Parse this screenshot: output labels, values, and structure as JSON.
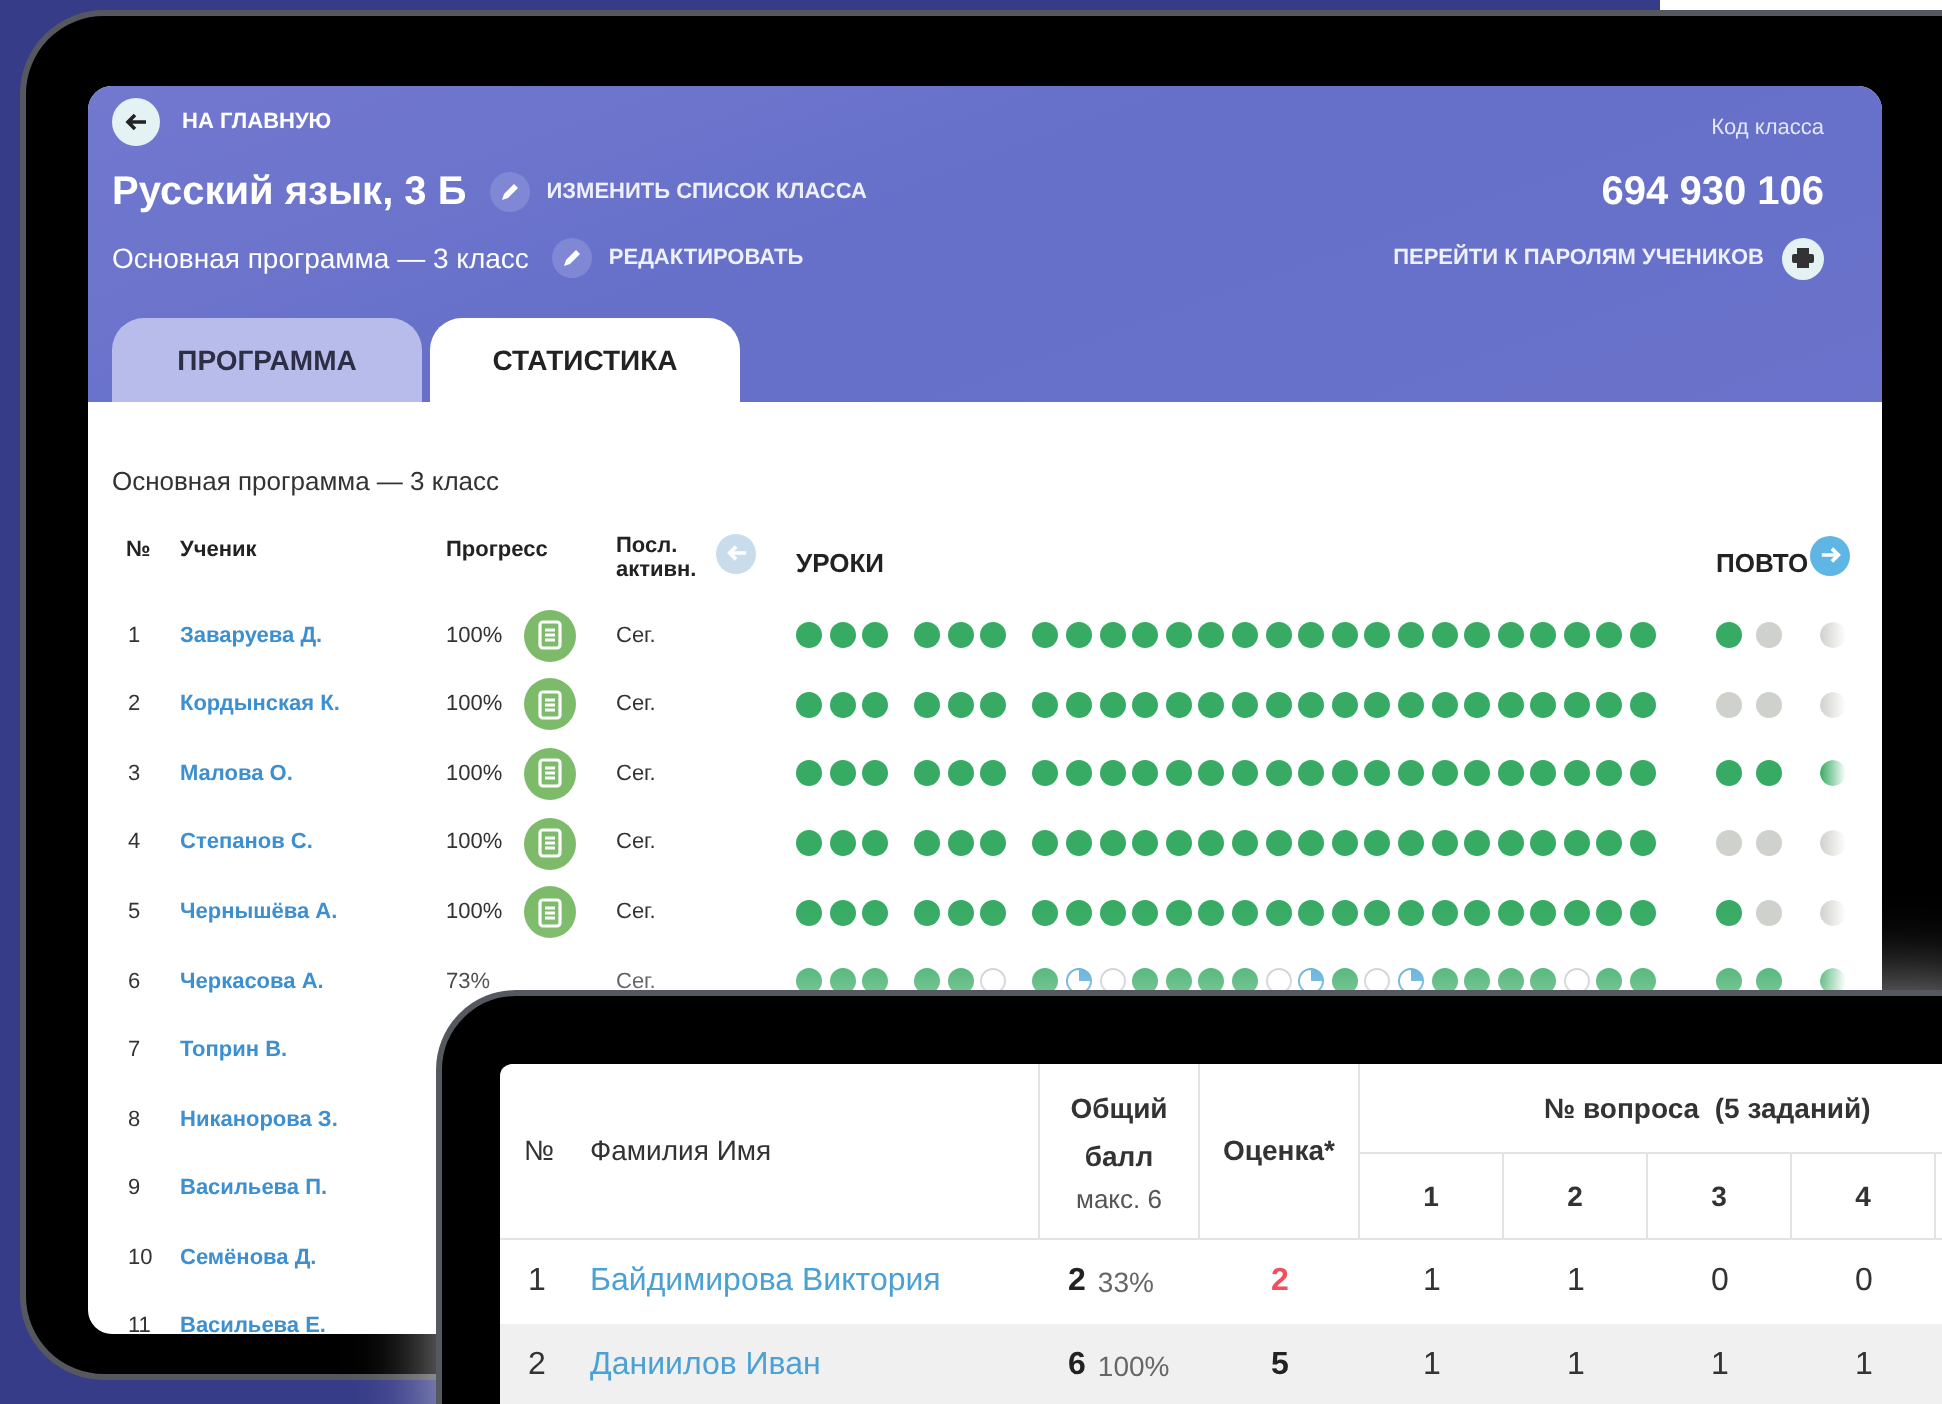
{
  "class_page": {
    "back_link": "НА ГЛАВНУЮ",
    "title": "Русский язык, 3 Б",
    "edit_list_link": "ИЗМЕНИТЬ СПИСОК КЛАССА",
    "program": "Основная программа — 3 класс",
    "edit_link": "РЕДАКТИРОВАТЬ",
    "code_label": "Код класса",
    "code": "694 930 106",
    "passwords_link": "ПЕРЕЙТИ К ПАРОЛЯМ УЧЕНИКОВ",
    "tabs": [
      {
        "label": "ПРОГРАММА",
        "selected": false
      },
      {
        "label": "СТАТИСТИКА",
        "selected": true
      }
    ],
    "section_title": "Основная программа — 3 класс",
    "columns": {
      "num": "№",
      "student": "Ученик",
      "progress": "Прогресс",
      "activity": "Посл. активн.",
      "lessons": "УРОКИ",
      "repeat": "ПОВТО"
    },
    "students": [
      {
        "num": "1",
        "name": "Заваруева Д.",
        "progress": "100%",
        "report": true,
        "activity": "Сег.",
        "lesson_groups": [
          [
            {
              "kind": "done"
            },
            {
              "kind": "done"
            },
            {
              "kind": "done"
            }
          ],
          [
            {
              "kind": "done"
            },
            {
              "kind": "done"
            },
            {
              "kind": "done"
            }
          ],
          [
            {
              "kind": "done"
            },
            {
              "kind": "done"
            },
            {
              "kind": "done"
            },
            {
              "kind": "done"
            },
            {
              "kind": "done"
            },
            {
              "kind": "done"
            },
            {
              "kind": "done"
            },
            {
              "kind": "done"
            },
            {
              "kind": "done"
            },
            {
              "kind": "done"
            },
            {
              "kind": "done"
            },
            {
              "kind": "done"
            },
            {
              "kind": "done"
            },
            {
              "kind": "done"
            },
            {
              "kind": "done"
            },
            {
              "kind": "done"
            },
            {
              "kind": "done"
            },
            {
              "kind": "done"
            },
            {
              "kind": "done"
            }
          ]
        ],
        "repeat": [
          {
            "kind": "done"
          },
          {
            "kind": "gray"
          },
          {
            "kind": "gray"
          }
        ]
      },
      {
        "num": "2",
        "name": "Кордынская К.",
        "progress": "100%",
        "report": true,
        "activity": "Сег.",
        "lesson_groups": [
          [
            {
              "kind": "done"
            },
            {
              "kind": "done"
            },
            {
              "kind": "done"
            }
          ],
          [
            {
              "kind": "done"
            },
            {
              "kind": "done"
            },
            {
              "kind": "done"
            }
          ],
          [
            {
              "kind": "done"
            },
            {
              "kind": "done"
            },
            {
              "kind": "done"
            },
            {
              "kind": "done"
            },
            {
              "kind": "done"
            },
            {
              "kind": "done"
            },
            {
              "kind": "done"
            },
            {
              "kind": "done"
            },
            {
              "kind": "done"
            },
            {
              "kind": "done"
            },
            {
              "kind": "done"
            },
            {
              "kind": "done"
            },
            {
              "kind": "done"
            },
            {
              "kind": "done"
            },
            {
              "kind": "done"
            },
            {
              "kind": "done"
            },
            {
              "kind": "done"
            },
            {
              "kind": "done"
            },
            {
              "kind": "done"
            }
          ]
        ],
        "repeat": [
          {
            "kind": "gray"
          },
          {
            "kind": "gray"
          },
          {
            "kind": "gray"
          }
        ]
      },
      {
        "num": "3",
        "name": "Малова О.",
        "progress": "100%",
        "report": true,
        "activity": "Сег.",
        "lesson_groups": [
          [
            {
              "kind": "done"
            },
            {
              "kind": "done"
            },
            {
              "kind": "done"
            }
          ],
          [
            {
              "kind": "done"
            },
            {
              "kind": "done"
            },
            {
              "kind": "done"
            }
          ],
          [
            {
              "kind": "done"
            },
            {
              "kind": "done"
            },
            {
              "kind": "done"
            },
            {
              "kind": "done"
            },
            {
              "kind": "done"
            },
            {
              "kind": "done"
            },
            {
              "kind": "done"
            },
            {
              "kind": "done"
            },
            {
              "kind": "done"
            },
            {
              "kind": "done"
            },
            {
              "kind": "done"
            },
            {
              "kind": "done"
            },
            {
              "kind": "done"
            },
            {
              "kind": "done"
            },
            {
              "kind": "done"
            },
            {
              "kind": "done"
            },
            {
              "kind": "done"
            },
            {
              "kind": "done"
            },
            {
              "kind": "done"
            }
          ]
        ],
        "repeat": [
          {
            "kind": "done"
          },
          {
            "kind": "done"
          },
          {
            "kind": "done"
          }
        ]
      },
      {
        "num": "4",
        "name": "Степанов С.",
        "progress": "100%",
        "report": true,
        "activity": "Сег.",
        "lesson_groups": [
          [
            {
              "kind": "done"
            },
            {
              "kind": "done"
            },
            {
              "kind": "done"
            }
          ],
          [
            {
              "kind": "done"
            },
            {
              "kind": "done"
            },
            {
              "kind": "done"
            }
          ],
          [
            {
              "kind": "done"
            },
            {
              "kind": "done"
            },
            {
              "kind": "done"
            },
            {
              "kind": "done"
            },
            {
              "kind": "done"
            },
            {
              "kind": "done"
            },
            {
              "kind": "done"
            },
            {
              "kind": "done"
            },
            {
              "kind": "done"
            },
            {
              "kind": "done"
            },
            {
              "kind": "done"
            },
            {
              "kind": "done"
            },
            {
              "kind": "done"
            },
            {
              "kind": "done"
            },
            {
              "kind": "done"
            },
            {
              "kind": "done"
            },
            {
              "kind": "done"
            },
            {
              "kind": "done"
            },
            {
              "kind": "done"
            }
          ]
        ],
        "repeat": [
          {
            "kind": "gray"
          },
          {
            "kind": "gray"
          },
          {
            "kind": "gray"
          }
        ]
      },
      {
        "num": "5",
        "name": "Чернышёва А.",
        "progress": "100%",
        "report": true,
        "activity": "Сег.",
        "lesson_groups": [
          [
            {
              "kind": "done"
            },
            {
              "kind": "done"
            },
            {
              "kind": "done"
            }
          ],
          [
            {
              "kind": "done"
            },
            {
              "kind": "done"
            },
            {
              "kind": "done"
            }
          ],
          [
            {
              "kind": "done"
            },
            {
              "kind": "done"
            },
            {
              "kind": "done"
            },
            {
              "kind": "done"
            },
            {
              "kind": "done"
            },
            {
              "kind": "done"
            },
            {
              "kind": "done"
            },
            {
              "kind": "done"
            },
            {
              "kind": "done"
            },
            {
              "kind": "done"
            },
            {
              "kind": "done"
            },
            {
              "kind": "done"
            },
            {
              "kind": "done"
            },
            {
              "kind": "done"
            },
            {
              "kind": "done"
            },
            {
              "kind": "done"
            },
            {
              "kind": "done"
            },
            {
              "kind": "done"
            },
            {
              "kind": "done"
            }
          ]
        ],
        "repeat": [
          {
            "kind": "done"
          },
          {
            "kind": "gray"
          },
          {
            "kind": "gray"
          }
        ]
      },
      {
        "num": "6",
        "name": "Черкасова А.",
        "progress": "73%",
        "report": false,
        "activity": "Сег.",
        "lesson_groups": [
          [
            {
              "kind": "done"
            },
            {
              "kind": "done"
            },
            {
              "kind": "done"
            }
          ],
          [
            {
              "kind": "done"
            },
            {
              "kind": "done"
            },
            {
              "kind": "empty"
            }
          ],
          [
            {
              "kind": "done"
            },
            {
              "kind": "partial"
            },
            {
              "kind": "empty"
            },
            {
              "kind": "done"
            },
            {
              "kind": "done"
            },
            {
              "kind": "done"
            },
            {
              "kind": "done"
            },
            {
              "kind": "empty"
            },
            {
              "kind": "partial"
            },
            {
              "kind": "done"
            },
            {
              "kind": "empty"
            },
            {
              "kind": "partial"
            },
            {
              "kind": "done"
            },
            {
              "kind": "done"
            },
            {
              "kind": "done"
            },
            {
              "kind": "done"
            },
            {
              "kind": "empty"
            },
            {
              "kind": "done"
            },
            {
              "kind": "done"
            }
          ]
        ],
        "repeat": [
          {
            "kind": "done"
          },
          {
            "kind": "done"
          },
          {
            "kind": "done"
          }
        ]
      },
      {
        "num": "7",
        "name": "Топрин В."
      },
      {
        "num": "8",
        "name": "Никанорова З."
      },
      {
        "num": "9",
        "name": "Васильева П."
      },
      {
        "num": "10",
        "name": "Семёнова Д."
      },
      {
        "num": "11",
        "name": "Васильева Е."
      }
    ]
  },
  "results": {
    "columns": {
      "num": "№",
      "name": "Фамилия Имя",
      "score": "Общий балл",
      "score_max": "макс. 6",
      "grade": "Оценка*",
      "questions": "№ вопроса  (5 заданий)"
    },
    "question_numbers": [
      "1",
      "2",
      "3",
      "4"
    ],
    "rows": [
      {
        "num": "1",
        "name": "Байдимирова Виктория",
        "score": "2",
        "percent": "33%",
        "grade": "2",
        "failing": true,
        "answers": [
          "1",
          "1",
          "0",
          "0"
        ]
      },
      {
        "num": "2",
        "name": "Даниилов Иван",
        "score": "6",
        "percent": "100%",
        "grade": "5",
        "failing": false,
        "answers": [
          "1",
          "1",
          "1",
          "1"
        ]
      }
    ]
  }
}
